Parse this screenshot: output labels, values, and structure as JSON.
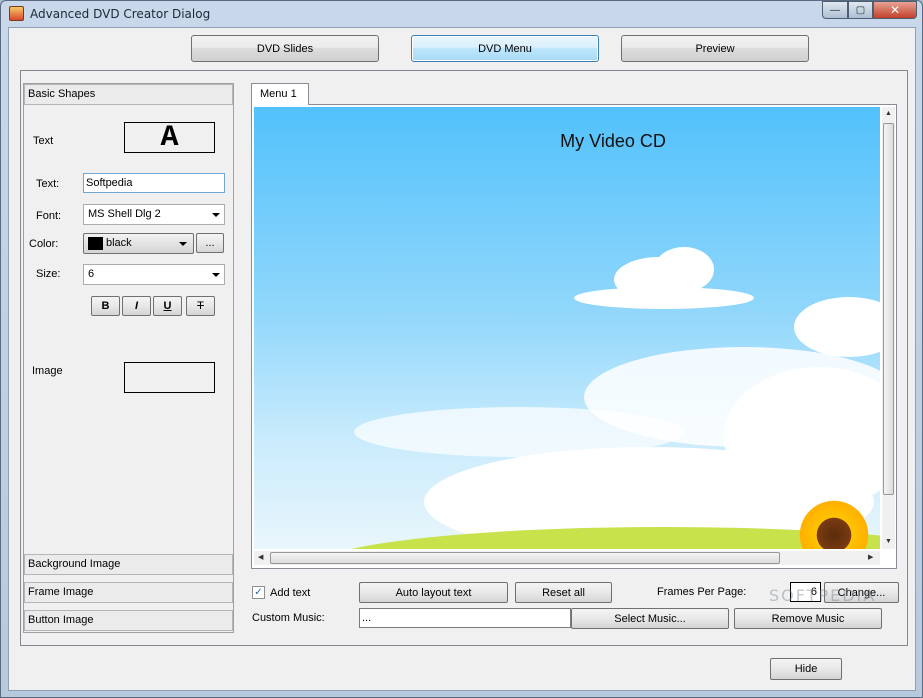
{
  "window": {
    "title": "Advanced DVD Creator Dialog"
  },
  "caption": {
    "minimize": "—",
    "maximize": "▢",
    "close": "✕"
  },
  "top_tabs": {
    "slides": "DVD Slides",
    "menu": "DVD Menu",
    "preview": "Preview"
  },
  "left": {
    "basic_shapes": "Basic Shapes",
    "text_label": "Text",
    "text_preview": "A",
    "text_field_label": "Text:",
    "text_value": "Softpedia",
    "font_label": "Font:",
    "font_value": "MS Shell Dlg 2",
    "color_label": "Color:",
    "color_value": "black",
    "color_swatch": "#000000",
    "color_more": "...",
    "size_label": "Size:",
    "size_value": "6",
    "bold": "B",
    "italic": "I",
    "underline": "U",
    "strike": "T",
    "image_label": "Image",
    "background_image": "Background Image",
    "frame_image": "Frame Image",
    "button_image": "Button Image"
  },
  "canvas": {
    "tab": "Menu 1",
    "title": "My Video CD"
  },
  "bottom": {
    "add_text": "Add text",
    "add_text_checked": true,
    "auto_layout": "Auto layout text",
    "reset_all": "Reset all",
    "frames_per_page_label": "Frames Per Page:",
    "frames_per_page": "6",
    "change": "Change...",
    "custom_music_label": "Custom Music:",
    "custom_music_value": "...",
    "select_music": "Select Music...",
    "remove_music": "Remove Music",
    "hide": "Hide"
  },
  "watermark": "SOFTPEDIA"
}
